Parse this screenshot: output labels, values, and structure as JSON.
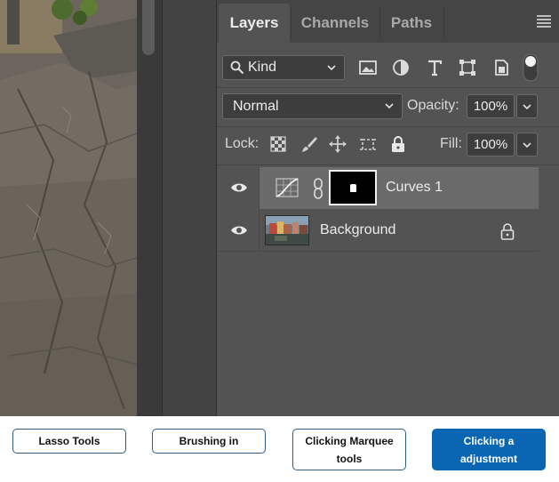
{
  "panel": {
    "tabs": [
      {
        "label": "Layers",
        "active": true
      },
      {
        "label": "Channels",
        "active": false
      },
      {
        "label": "Paths",
        "active": false
      }
    ],
    "menu_icon": "hamburger-menu-icon"
  },
  "filter": {
    "kind_label": "Kind",
    "filter_icons": [
      "image-filter-icon",
      "adjustment-filter-icon",
      "type-filter-icon",
      "shape-filter-icon",
      "smart-object-filter-icon"
    ],
    "toggle_icon": "filter-toggle-icon"
  },
  "blend": {
    "mode": "Normal",
    "opacity_label": "Opacity:",
    "opacity_value": "100%"
  },
  "lock": {
    "label": "Lock:",
    "icons": [
      "lock-transparent-pixels-icon",
      "lock-image-pixels-icon",
      "lock-position-icon",
      "lock-artboard-icon",
      "lock-all-icon"
    ],
    "fill_label": "Fill:",
    "fill_value": "100%"
  },
  "layers": [
    {
      "name": "Curves 1",
      "visible": true,
      "selected": true,
      "type": "curves-adjustment",
      "has_mask": true
    },
    {
      "name": "Background",
      "visible": true,
      "selected": false,
      "type": "image",
      "locked": true
    }
  ],
  "options": [
    {
      "label": "Lasso Tools",
      "selected": false
    },
    {
      "label": "Brushing in",
      "selected": false
    },
    {
      "label": "Clicking Marquee tools",
      "selected": false
    },
    {
      "label": "Clicking a adjustment",
      "selected": true
    }
  ],
  "colors": {
    "panel_bg": "#535353",
    "selected_row": "#6a6a6a",
    "accent": "#0a66b2"
  }
}
